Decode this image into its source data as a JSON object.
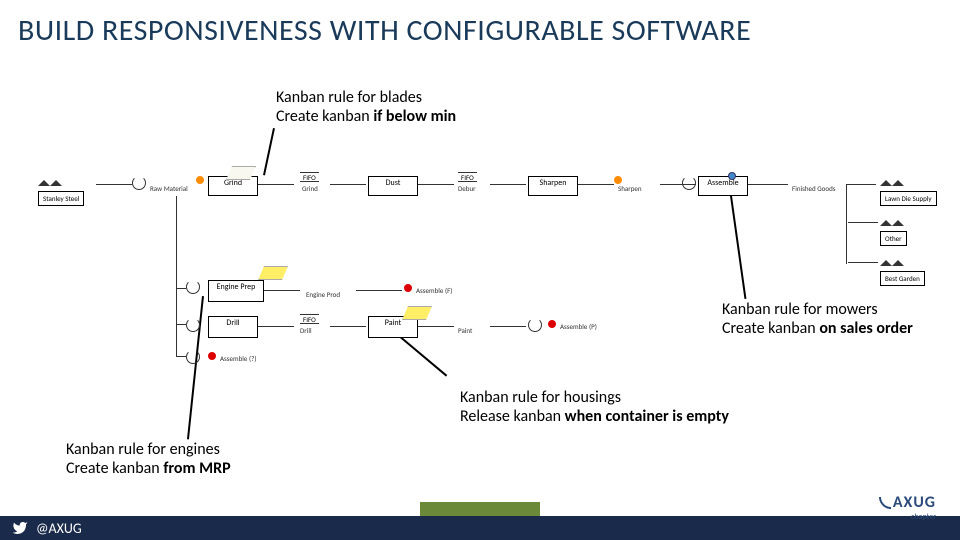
{
  "title": "BUILD RESPONSIVENESS WITH CONFIGURABLE SOFTWARE",
  "callouts": {
    "blades": {
      "line1": "Kanban rule for blades",
      "line2a": "Create kanban ",
      "line2b": "if below min"
    },
    "mowers": {
      "line1": "Kanban rule for mowers",
      "line2a": "Create kanban ",
      "line2b": "on sales order"
    },
    "housings": {
      "line1": "Kanban rule for housings",
      "line2a": "Release kanban ",
      "line2b": "when container is empty"
    },
    "engines": {
      "line1": "Kanban rule for engines",
      "line2a": "Create kanban ",
      "line2b": "from MRP"
    }
  },
  "nodes": {
    "stanley": "Stanley Steel",
    "rawmat": "Raw Material",
    "grind": "Grind",
    "fifo1": "FIFO",
    "dust": "Dust",
    "fifo2": "FIFO",
    "sharpen": "Sharpen",
    "sharpenq": "Sharpen",
    "assemble": "Assemble",
    "finished": "Finished Goods",
    "lawn": "Lawn Die Supply",
    "other": "Other",
    "best": "Best Garden",
    "engineprep": "Engine Prep",
    "engineprodq": "Engine Prod",
    "drill": "Drill",
    "drill2": "Drill",
    "paint": "Paint",
    "paintq": "Paint",
    "assembleF": "Assemble (F)",
    "assembleP": "Assemble (P)",
    "assembleQ": "Assemble (?)",
    "fifo3": "FIFO"
  },
  "footer": {
    "handle": "@AXUG"
  },
  "brand": {
    "name": "AXUG",
    "sub": "chapter"
  }
}
